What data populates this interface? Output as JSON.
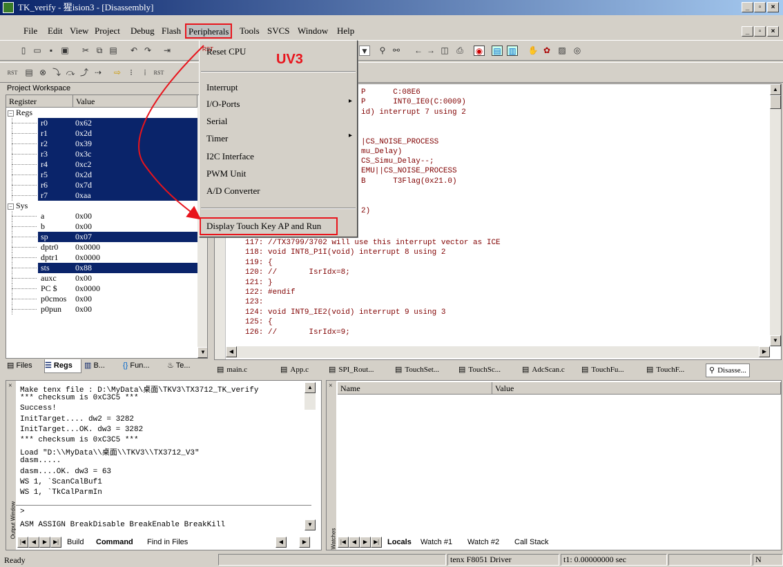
{
  "window": {
    "title": "TK_verify - 猩ision3 - [Disassembly]"
  },
  "menu": [
    "File",
    "Edit",
    "View",
    "Project",
    "Debug",
    "Flash",
    "Peripherals",
    "Tools",
    "SVCS",
    "Window",
    "Help"
  ],
  "annotation": {
    "label": "UV3",
    "color": "#e8141c"
  },
  "peripherals_menu": {
    "items": [
      "Reset CPU",
      "Interrupt",
      "I/O-Ports",
      "Serial",
      "Timer",
      "I2C Interface",
      "PWM Unit",
      "A/D Converter",
      "Display Touch Key AP and Run"
    ]
  },
  "workspace": {
    "title": "Project Workspace",
    "columns": [
      "Register",
      "Value"
    ],
    "regs_group": "Regs",
    "regs": [
      {
        "name": "r0",
        "value": "0x62"
      },
      {
        "name": "r1",
        "value": "0x2d"
      },
      {
        "name": "r2",
        "value": "0x39"
      },
      {
        "name": "r3",
        "value": "0x3c"
      },
      {
        "name": "r4",
        "value": "0xc2"
      },
      {
        "name": "r5",
        "value": "0x2d"
      },
      {
        "name": "r6",
        "value": "0x7d"
      },
      {
        "name": "r7",
        "value": "0xaa"
      }
    ],
    "sys_group": "Sys",
    "sys": [
      {
        "name": "a",
        "value": "0x00"
      },
      {
        "name": "b",
        "value": "0x00"
      },
      {
        "name": "sp",
        "value": "0x07"
      },
      {
        "name": "dptr0",
        "value": "0x0000"
      },
      {
        "name": "dptr1",
        "value": "0x0000"
      },
      {
        "name": "sts",
        "value": "0x88"
      },
      {
        "name": "auxc",
        "value": "0x00"
      },
      {
        "name": "PC $",
        "value": "0x0000"
      },
      {
        "name": "p0cmos",
        "value": "0x00"
      },
      {
        "name": "p0pun",
        "value": "0x00"
      }
    ],
    "tabs": [
      "Files",
      "Regs",
      "B...",
      "Fun...",
      "Te..."
    ]
  },
  "disasm": {
    "lines_top": [
      "P      C:08E6",
      "P      INT0_IE0(C:0009)",
      "id) interrupt 7 using 2",
      "",
      "",
      "|CS_NOISE_PROCESS",
      "mu_Delay)",
      "CS_Simu_Delay--;",
      "EMU||CS_NOISE_PROCESS",
      "B      T3Flag(0x21.0)",
      "",
      "",
      "2)"
    ],
    "lines": [
      "117: //TX3799/3702 will use this interrupt vector as ICE",
      "118: void INT8_P1I(void) interrupt 8 using 2",
      "119: {",
      "120: //       IsrIdx=8;",
      "121: }",
      "122: #endif",
      "123:",
      "124: void INT9_IE2(void) interrupt 9 using 3",
      "125: {",
      "126: //       IsrIdx=9;"
    ],
    "tabs": [
      "main.c",
      "App.c",
      "SPI_Rout...",
      "TouchSet...",
      "TouchSc...",
      "AdcScan.c",
      "TouchFu...",
      "TouchF...",
      "Disasse..."
    ]
  },
  "output": {
    "lines": [
      "Make tenx file : D:\\MyData\\桌面\\TKV3\\TX3712_TK_verify",
      "*** checksum is 0xC3C5 ***",
      "Success!",
      "InitTarget.... dw2 = 3282",
      "InitTarget...OK. dw3 = 3282",
      "*** checksum is 0xC3C5 ***",
      "Load \"D:\\\\MyData\\\\桌面\\\\TKV3\\\\TX3712_V3\"",
      "dasm.....",
      "dasm....OK. dw3 = 63",
      "WS 1, `ScanCalBuf1",
      "WS 1, `TkCalParmIn"
    ],
    "prompt": ">",
    "cmd_hint": "ASM ASSIGN BreakDisable BreakEnable BreakKill",
    "side_label": "Output Window",
    "tabs": [
      "Build",
      "Command",
      "Find in Files"
    ]
  },
  "watch": {
    "columns": [
      "Name",
      "Value"
    ],
    "side_label": "Watches",
    "tabs": [
      "Locals",
      "Watch #1",
      "Watch #2",
      "Call Stack"
    ]
  },
  "status": {
    "ready": "Ready",
    "driver": "tenx F8051 Driver",
    "time": "t1: 0.00000000 sec",
    "end": "N"
  }
}
